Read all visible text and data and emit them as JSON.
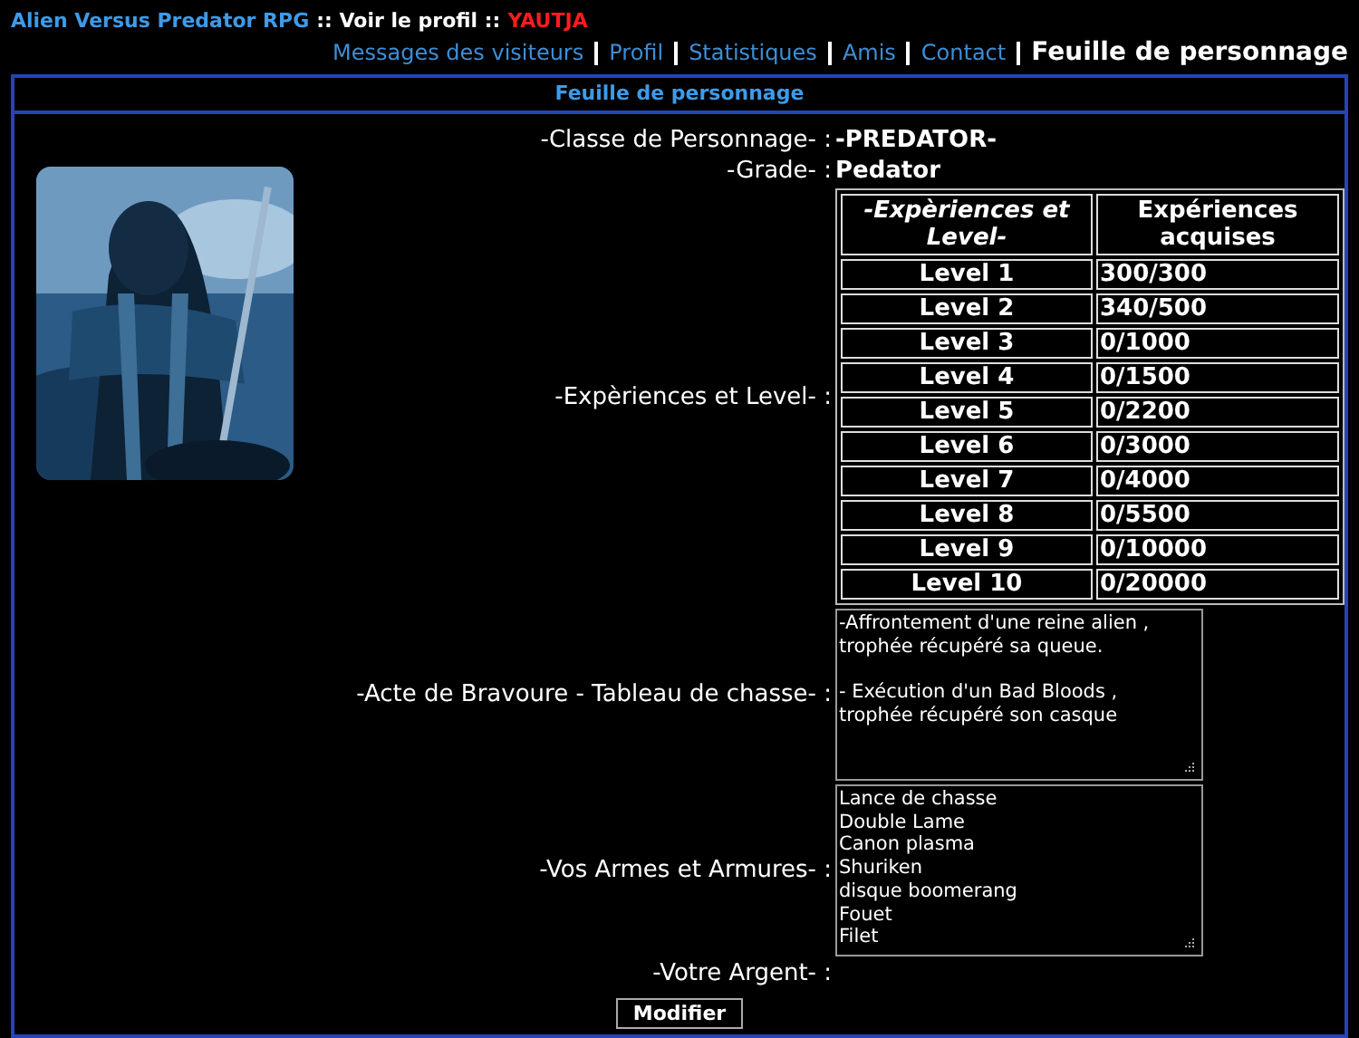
{
  "breadcrumb": [
    {
      "kind": "link",
      "text": "Alien Versus Predator RPG"
    },
    {
      "kind": "text",
      "text": ":: Voir le profil ::"
    },
    {
      "kind": "user",
      "text": "YAUTJA"
    }
  ],
  "tabs": [
    {
      "label": "Messages des visiteurs",
      "selected": false
    },
    {
      "label": "Profil",
      "selected": false
    },
    {
      "label": "Statistiques",
      "selected": false
    },
    {
      "label": "Amis",
      "selected": false
    },
    {
      "label": "Contact",
      "selected": false
    },
    {
      "label": "Feuille de personnage",
      "selected": true
    }
  ],
  "panel": {
    "title": "Feuille de personnage",
    "fields": [
      {
        "kind": "text",
        "label": "-Classe de Personnage- :",
        "value": "-PREDATOR-"
      },
      {
        "kind": "text",
        "label": "-Grade- :",
        "value": "Pedator"
      },
      {
        "kind": "table",
        "label": "-Expèriences et Level- :",
        "columns": [
          "-Expèriences et Level-",
          "Expériences acquises"
        ],
        "rows": [
          [
            "Level 1",
            "300/300"
          ],
          [
            "Level 2",
            "340/500"
          ],
          [
            "Level 3",
            "0/1000"
          ],
          [
            "Level 4",
            "0/1500"
          ],
          [
            "Level 5",
            "0/2200"
          ],
          [
            "Level 6",
            "0/3000"
          ],
          [
            "Level 7",
            "0/4000"
          ],
          [
            "Level 8",
            "0/5500"
          ],
          [
            "Level 9",
            "0/10000"
          ],
          [
            "Level 10",
            "0/20000"
          ]
        ]
      },
      {
        "kind": "textarea",
        "label": "-Acte de Bravoure - Tableau de chasse- :",
        "value": "-Affrontement d'une reine alien ,\ntrophée récupéré sa queue.\n\n- Exécution d'un Bad Bloods ,\ntrophée récupéré son casque"
      },
      {
        "kind": "textarea",
        "label": "-Vos Armes et Armures- :",
        "value": "Lance de chasse\nDouble Lame\nCanon plasma\nShuriken\ndisque boomerang\nFouet\nFilet"
      },
      {
        "kind": "empty",
        "label": "-Votre Argent- :"
      }
    ],
    "button": "Modifier"
  }
}
